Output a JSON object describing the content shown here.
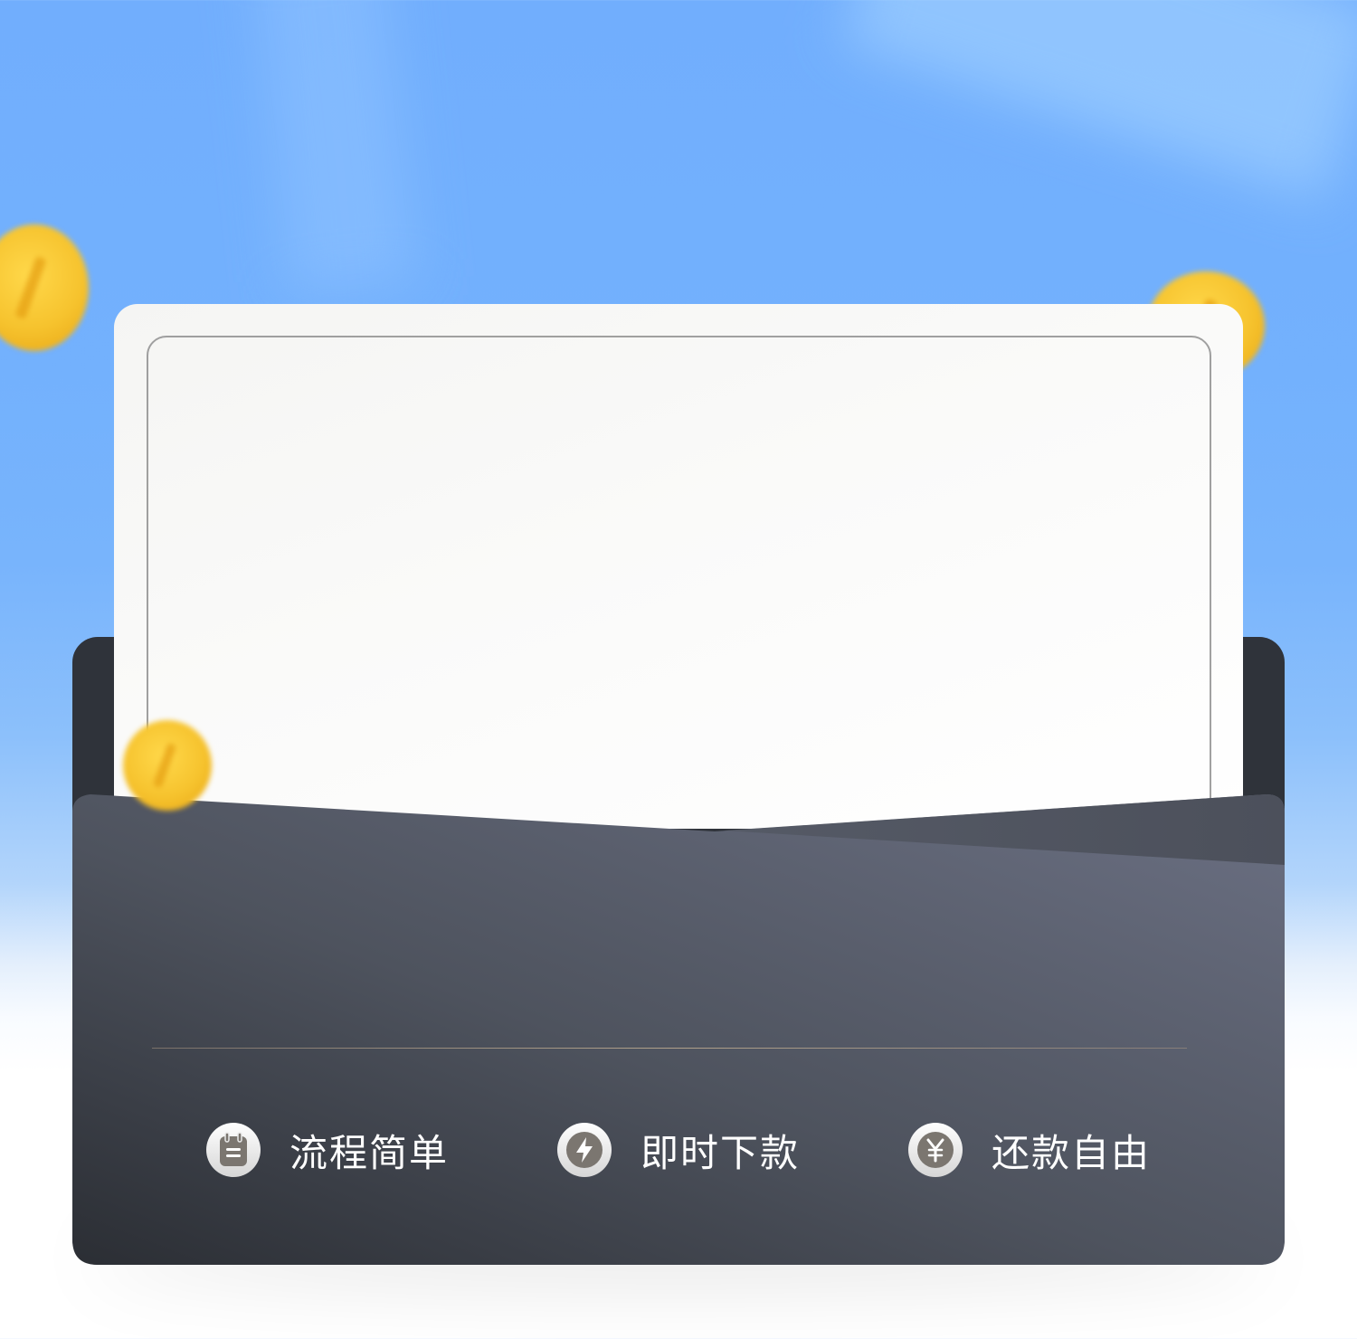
{
  "features": [
    {
      "label": "流程简单",
      "icon": "clipboard-icon"
    },
    {
      "label": "即时下款",
      "icon": "lightning-icon"
    },
    {
      "label": "还款自由",
      "icon": "yen-coin-icon"
    }
  ],
  "colors": {
    "sky": "#71aefd",
    "wallet_dark": "#2c2f35",
    "wallet_light": "#6b7083",
    "coin": "#f6c32e",
    "card": "#fafaf9",
    "icon_glyph": "#7b7670"
  }
}
